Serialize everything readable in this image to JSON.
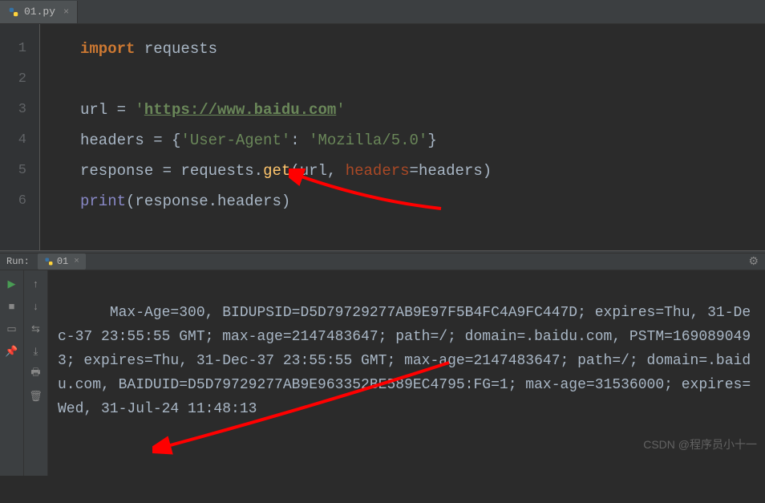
{
  "tab": {
    "filename": "01.py"
  },
  "editor": {
    "lines": [
      {
        "n": "1",
        "parts": [
          {
            "t": "import",
            "c": "kw"
          },
          {
            "t": " ",
            "c": "op"
          },
          {
            "t": "requests",
            "c": "ident"
          }
        ]
      },
      {
        "n": "2",
        "parts": []
      },
      {
        "n": "3",
        "parts": [
          {
            "t": "url ",
            "c": "ident"
          },
          {
            "t": "= ",
            "c": "op"
          },
          {
            "t": "'",
            "c": "str"
          },
          {
            "t": "https://www.baidu.com",
            "c": "url-str"
          },
          {
            "t": "'",
            "c": "str"
          }
        ]
      },
      {
        "n": "4",
        "parts": [
          {
            "t": "headers ",
            "c": "ident"
          },
          {
            "t": "= ",
            "c": "op"
          },
          {
            "t": "{",
            "c": "paren"
          },
          {
            "t": "'User-Agent'",
            "c": "str"
          },
          {
            "t": ": ",
            "c": "op"
          },
          {
            "t": "'Mozilla/5.0'",
            "c": "str"
          },
          {
            "t": "}",
            "c": "paren"
          }
        ]
      },
      {
        "n": "5",
        "parts": [
          {
            "t": "response ",
            "c": "ident"
          },
          {
            "t": "= ",
            "c": "op"
          },
          {
            "t": "requests",
            "c": "ident"
          },
          {
            "t": ".",
            "c": "op"
          },
          {
            "t": "get",
            "c": "fn"
          },
          {
            "t": "(",
            "c": "paren"
          },
          {
            "t": "url",
            "c": "ident"
          },
          {
            "t": ", ",
            "c": "op"
          },
          {
            "t": "headers",
            "c": "param"
          },
          {
            "t": "=",
            "c": "op"
          },
          {
            "t": "headers",
            "c": "ident"
          },
          {
            "t": ")",
            "c": "paren"
          }
        ]
      },
      {
        "n": "6",
        "parts": [
          {
            "t": "print",
            "c": "builtin"
          },
          {
            "t": "(",
            "c": "paren"
          },
          {
            "t": "response",
            "c": "ident"
          },
          {
            "t": ".",
            "c": "op"
          },
          {
            "t": "headers",
            "c": "ident"
          },
          {
            "t": ")",
            "c": "paren"
          }
        ]
      }
    ]
  },
  "run": {
    "label": "Run:",
    "tab": "01"
  },
  "console_output": "Max-Age=300, BIDUPSID=D5D79729277AB9E97F5B4FC4A9FC447D; expires=Thu, 31-Dec-37 23:55:55 GMT; max-age=2147483647; path=/; domain=.baidu.com, PSTM=1690890493; expires=Thu, 31-Dec-37 23:55:55 GMT; max-age=2147483647; path=/; domain=.baidu.com, BAIDUID=D5D79729277AB9E963352BE589EC4795:FG=1; max-age=31536000; expires=Wed, 31-Jul-24 11:48:13",
  "watermark": "CSDN @程序员小十一"
}
